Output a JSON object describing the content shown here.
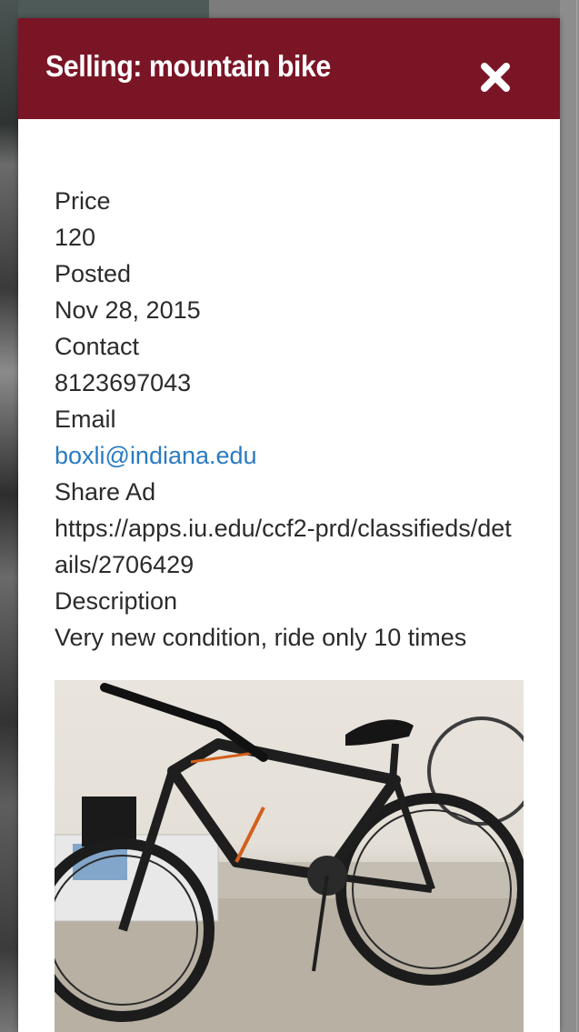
{
  "modal": {
    "title": "Selling: mountain bike",
    "close_icon": "close-icon"
  },
  "details": {
    "price_label": "Price",
    "price_value": "120",
    "posted_label": "Posted",
    "posted_value": "Nov 28, 2015",
    "contact_label": "Contact",
    "contact_value": "8123697043",
    "email_label": "Email",
    "email_value": "boxli@indiana.edu",
    "share_label": "Share Ad",
    "share_value": "https://apps.iu.edu/ccf2-prd/classifieds/details/2706429",
    "description_label": "Description",
    "description_value": "Very new condition, ride only 10 times"
  },
  "photo": {
    "subject": "black mountain bike with orange accents"
  },
  "colors": {
    "header_bg": "#7a1526",
    "link": "#2a7bc0",
    "text": "#2b2b2b"
  }
}
